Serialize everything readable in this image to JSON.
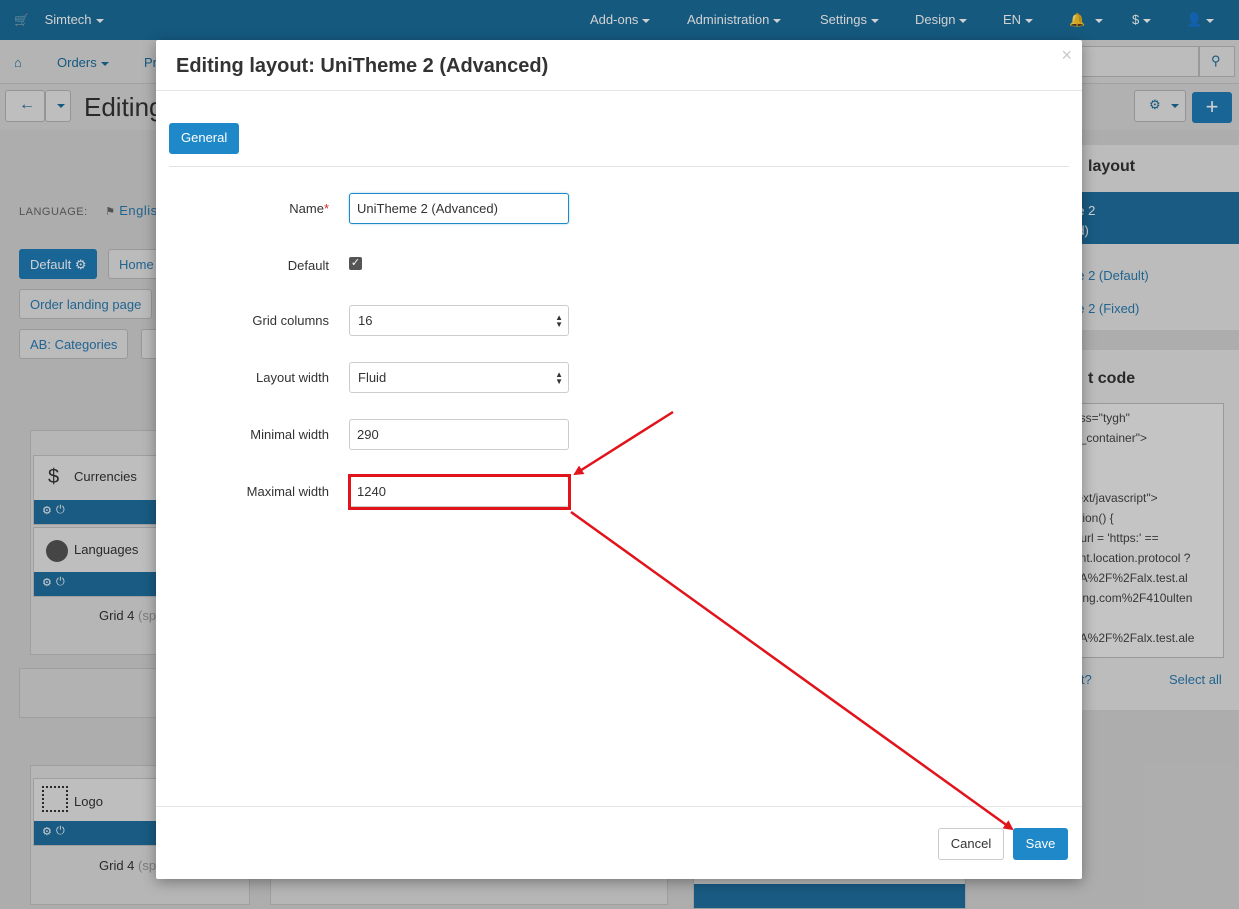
{
  "topbar": {
    "brand": "Simtech",
    "menus": [
      "Add-ons",
      "Administration",
      "Settings",
      "Design",
      "EN",
      "$"
    ]
  },
  "secondbar": {
    "orders": "Orders",
    "products_partial": "Pr"
  },
  "toolbar": {
    "title_partial": "Editing"
  },
  "background": {
    "language_label": "LANGUAGE:",
    "language_value": "Englis",
    "pills": [
      "Default",
      "Home",
      "Order landing page",
      "AB: Categories"
    ],
    "blocks": [
      "Currencies",
      "Languages",
      "Logo"
    ],
    "grid_label": "Grid 4",
    "grid_sub": "(sp",
    "side_title": "layout",
    "side_items": [
      "ne 2",
      "ed)",
      "ne 2 (Default)",
      "ne 2 (Fixed)"
    ],
    "code_title": "t code",
    "code_text": "ass=\"tygh\"\nh_container\">\n\n\ntext/javascript\">\nction() {\nr url = 'https:' ==\nent.location.protocol ?\n3A%2F%2Falx.test.al\nding.com%2F410ulten\n\n3A%2F%2Falx.test.ale",
    "code_link_left": "it?",
    "code_link_right": "Select all"
  },
  "modal": {
    "title": "Editing layout: UniTheme 2 (Advanced)",
    "close": "×",
    "tab_general": "General",
    "fields": {
      "name_label": "Name",
      "name_required": "*",
      "name_value": "UniTheme 2 (Advanced)",
      "default_label": "Default",
      "default_checked": true,
      "grid_columns_label": "Grid columns",
      "grid_columns_value": "16",
      "layout_width_label": "Layout width",
      "layout_width_value": "Fluid",
      "minimal_width_label": "Minimal width",
      "minimal_width_value": "290",
      "maximal_width_label": "Maximal width",
      "maximal_width_value": "1240"
    },
    "cancel_label": "Cancel",
    "save_label": "Save"
  },
  "colors": {
    "topbar": "#1a6d9c",
    "primary": "#1e88c9",
    "annotation": "#e1141c"
  }
}
